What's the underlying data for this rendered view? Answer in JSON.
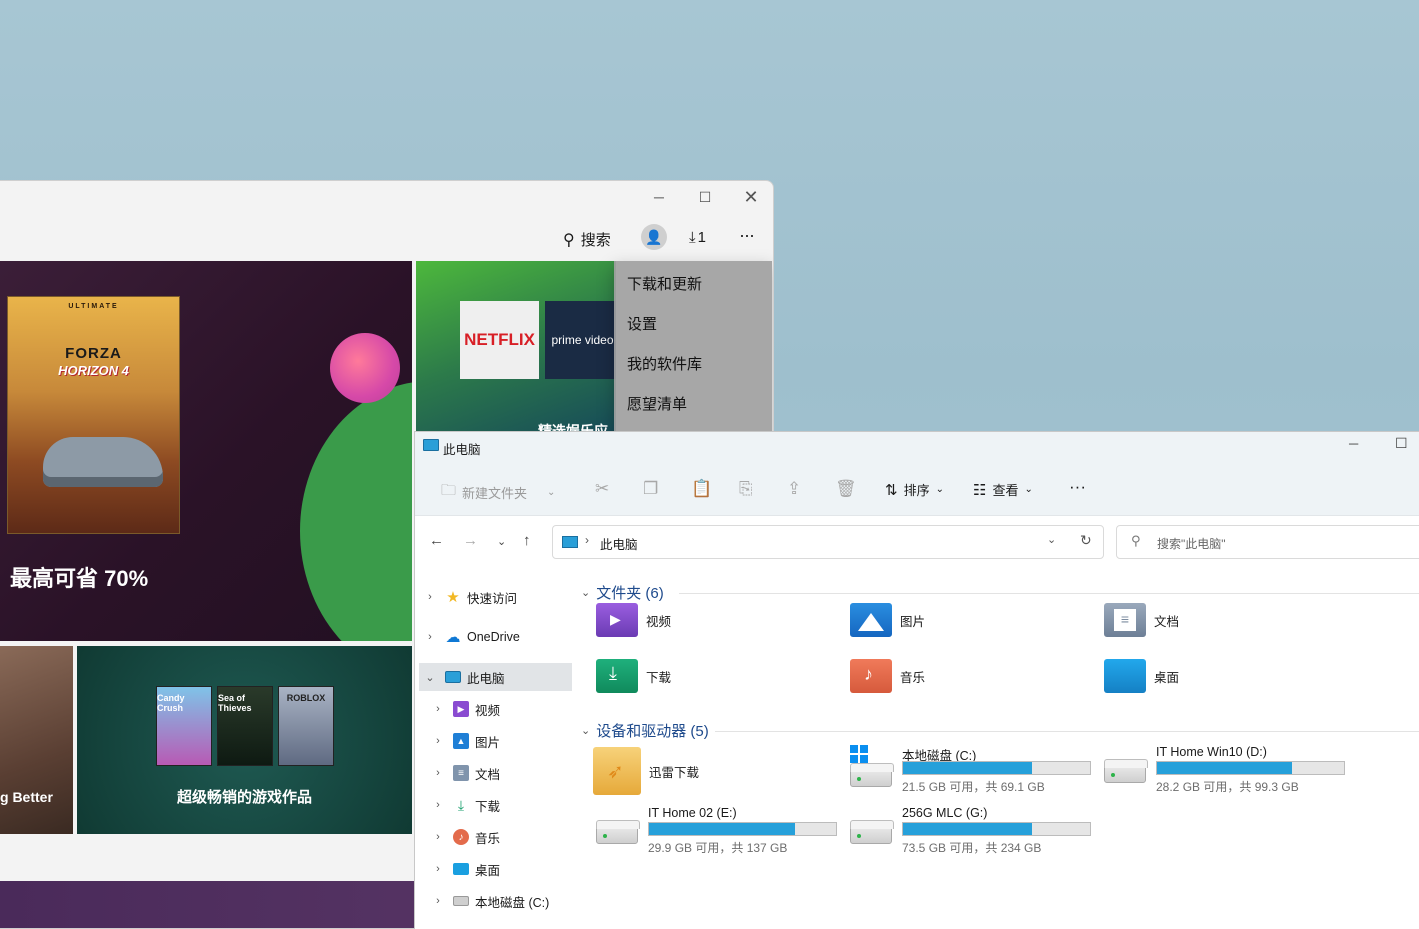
{
  "store": {
    "search_label": "搜索",
    "downloads_label": "1",
    "more_label": "···",
    "hero_forza": {
      "cover_ultimate": "ULTIMATE",
      "cover_title": "FORZA",
      "cover_subtitle": "HORIZON 4",
      "promo": "最高可省 70%"
    },
    "hero_entertainment": {
      "netflix": "NETFLIX",
      "prime": "prime video",
      "caption": "精选娱乐应"
    },
    "tile_better_caption": "g Better",
    "tile_games": {
      "caption": "超级畅销的游戏作品",
      "covers": [
        "Candy Crush",
        "Sea of Thieves",
        "ROBLOX"
      ]
    },
    "menu": [
      "下载和更新",
      "设置",
      "我的软件库",
      "愿望清单"
    ]
  },
  "explorer": {
    "title": "此电脑",
    "toolbar": {
      "new_folder": "新建文件夹",
      "sort": "排序",
      "view": "查看",
      "more": "···"
    },
    "address": "此电脑",
    "search_placeholder": "搜索\"此电脑\"",
    "nav": [
      {
        "label": "快速访问",
        "icon": "star-icon"
      },
      {
        "label": "OneDrive",
        "icon": "cloud-icon"
      },
      {
        "label": "此电脑",
        "icon": "monitor-icon"
      },
      {
        "label": "视频",
        "icon": "video-icon"
      },
      {
        "label": "图片",
        "icon": "pictures-icon"
      },
      {
        "label": "文档",
        "icon": "documents-icon"
      },
      {
        "label": "下载",
        "icon": "download-icon"
      },
      {
        "label": "音乐",
        "icon": "music-icon"
      },
      {
        "label": "桌面",
        "icon": "desktop-icon"
      },
      {
        "label": "本地磁盘 (C:)",
        "icon": "drive-icon"
      }
    ],
    "folders_header": "文件夹 (6)",
    "folders": [
      {
        "label": "视频",
        "icon": "video-folder-icon"
      },
      {
        "label": "图片",
        "icon": "pictures-folder-icon"
      },
      {
        "label": "文档",
        "icon": "documents-folder-icon"
      },
      {
        "label": "下载",
        "icon": "download-folder-icon"
      },
      {
        "label": "音乐",
        "icon": "music-folder-icon"
      },
      {
        "label": "桌面",
        "icon": "desktop-folder-icon"
      }
    ],
    "drives_header": "设备和驱动器 (5)",
    "app_folder": {
      "label": "迅雷下载",
      "icon": "xunlei-icon"
    },
    "drives": [
      {
        "name": "本地磁盘 (C:)",
        "free": "21.5 GB 可用，共 69.1 GB",
        "used_fraction": 0.69,
        "icon": "windows-drive-icon"
      },
      {
        "name": "IT Home Win10 (D:)",
        "free": "28.2 GB 可用，共 99.3 GB",
        "used_fraction": 0.72,
        "icon": "drive-icon"
      },
      {
        "name": "IT Home 02 (E:)",
        "free": "29.9 GB 可用，共 137 GB",
        "used_fraction": 0.78,
        "icon": "drive-icon"
      },
      {
        "name": "256G MLC (G:)",
        "free": "73.5 GB 可用，共 234 GB",
        "used_fraction": 0.69,
        "icon": "drive-icon"
      }
    ]
  }
}
